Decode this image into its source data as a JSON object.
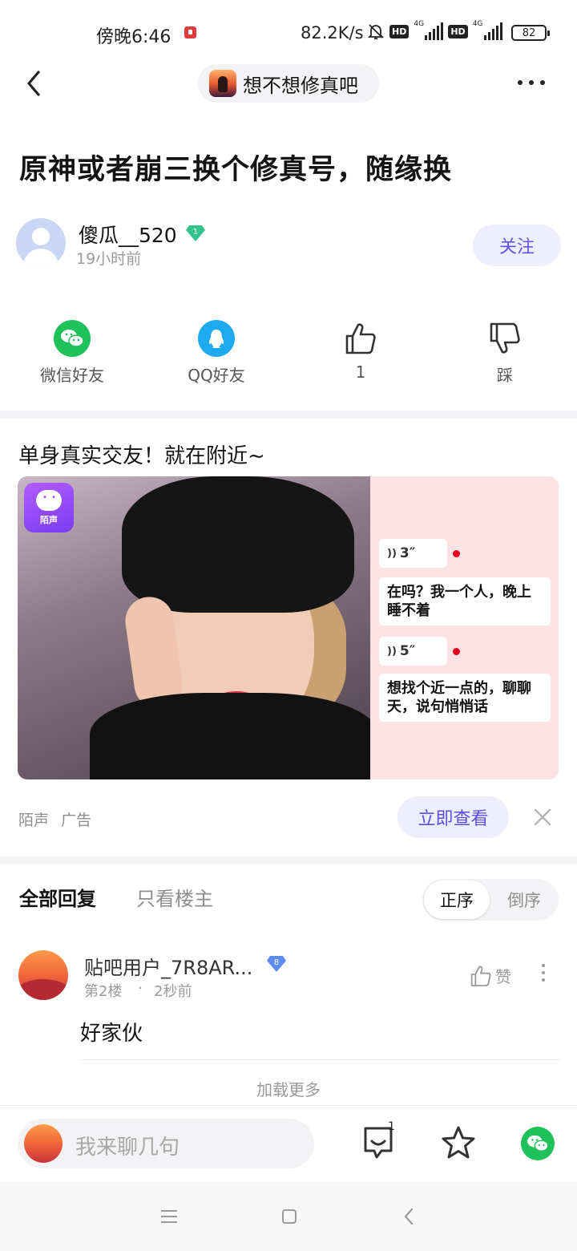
{
  "status_bar": {
    "time": "傍晚6:46",
    "net_speed": "82.2K/s",
    "net_type_1": "4G",
    "net_type_2": "4G",
    "hd": "HD",
    "battery": "82"
  },
  "nav": {
    "forum_name": "想不想修真吧"
  },
  "post": {
    "title": "原神或者崩三换个修真号，随缘换",
    "author": {
      "name": "傻瓜__520",
      "level": "1",
      "time": "19小时前"
    },
    "follow_label": "关注"
  },
  "share_actions": [
    {
      "label": "微信好友",
      "icon": "wechat-icon",
      "color": "#1fc15a"
    },
    {
      "label": "QQ好友",
      "icon": "qq-icon",
      "color": "#1eaaf1"
    },
    {
      "label": "1",
      "icon": "thumbs-up-icon"
    },
    {
      "label": "踩",
      "icon": "thumbs-down-icon"
    }
  ],
  "ad": {
    "title": "单身真实交友！就在附近~",
    "app_badge": "陌声",
    "voice_1": "3″",
    "message_1": "在吗？我一个人，晚上睡不着",
    "voice_2": "5″",
    "message_2": "想找个近一点的，聊聊天，说句悄悄话",
    "source": "陌声",
    "tag": "广告",
    "cta": "立即查看"
  },
  "replies_section": {
    "tab_all": "全部回复",
    "tab_op": "只看楼主",
    "sort_asc": "正序",
    "sort_desc": "倒序"
  },
  "replies": [
    {
      "user": "贴吧用户_7R8AR...",
      "level": "8",
      "floor": "第2楼",
      "sep": "·",
      "time": "2秒前",
      "like_label": "赞",
      "text": "好家伙"
    }
  ],
  "load_more": "加载更多",
  "bottom_bar": {
    "input_placeholder": "我来聊几句",
    "comment_count": "1"
  },
  "colors": {
    "accent": "#6153e6",
    "wechat": "#1fc15a",
    "qq": "#1eaaf1"
  }
}
